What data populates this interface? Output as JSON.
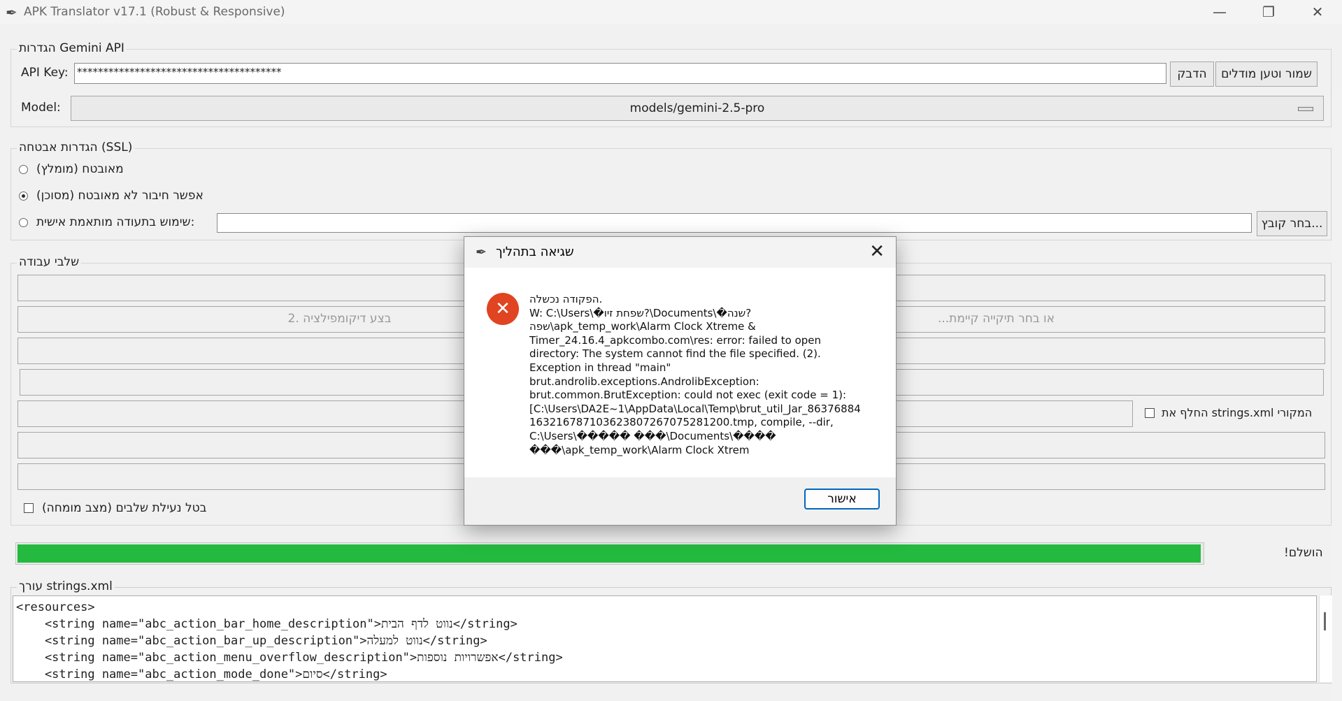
{
  "window": {
    "title": "APK Translator v17.1 (Robust & Responsive)",
    "minimize_glyph": "—",
    "restore_glyph": "❐",
    "close_glyph": "✕"
  },
  "api_group": {
    "legend": "הגדרות Gemini API",
    "api_key_label": "API Key:",
    "api_key_value": "***************************************",
    "paste_button": "הדבק",
    "save_load_button": "שמור וטען מודלים",
    "model_label": "Model:",
    "model_value": "models/gemini-2.5-pro"
  },
  "ssl_group": {
    "legend": "הגדרות אבטחה (SSL)",
    "options": [
      {
        "label": "מאובטח (מומלץ)",
        "selected": false
      },
      {
        "label": "אפשר חיבור לא מאובטח (מסוכן)",
        "selected": true
      },
      {
        "label": "שימוש בתעודה מותאמת אישית:",
        "selected": false
      }
    ],
    "cert_path": "",
    "choose_file_button": "בחר קובץ..."
  },
  "steps_group": {
    "legend": "שלבי עבודה",
    "decompile_button": "2. בצע דיקומפילציה",
    "choose_folder_button": "...או בחר תיקייה קיימת",
    "replace_strings_label": "החלף את strings.xml המקורי",
    "disable_lock_label": "בטל נעילת שלבים (מצב מומחה)"
  },
  "progress": {
    "value_percent": 100,
    "status": "!הושלם"
  },
  "editor": {
    "legend": "עורך strings.xml",
    "lines": [
      "<resources>",
      "    <string name=\"abc_action_bar_home_description\">נווט לדף הבית</string>",
      "    <string name=\"abc_action_bar_up_description\">נווט למעלה</string>",
      "    <string name=\"abc_action_menu_overflow_description\">אפשרויות נוספות</string>",
      "    <string name=\"abc_action_mode_done\">סיום</string>"
    ]
  },
  "dialog": {
    "title": "שגיאה בתהליך",
    "icon": "error-icon",
    "message_lines": [
      "הפקודה נכשלה.",
      "W: C:\\Users\\�שפחת זיו?\\Documents\\�שנה?",
      "שפה\\apk_temp_work\\Alarm Clock Xtreme &",
      "Timer_24.16.4_apkcombo.com\\res: error: failed to open",
      "directory: The system cannot find the file specified. (2).",
      "Exception in thread \"main\"",
      "brut.androlib.exceptions.AndrolibException:",
      "brut.common.BrutException: could not exec (exit code = 1):",
      "[C:\\Users\\DA2E~1\\AppData\\Local\\Temp\\brut_util_Jar_86376884",
      "16321678710362380726​7075281200.tmp, compile, --dir,",
      "C:\\Users\\����� ���\\Documents\\����",
      "���\\apk_temp_work\\Alarm Clock Xtrem"
    ],
    "ok_button": "אישור",
    "accent_color": "#0067c0",
    "error_color": "#e04420"
  }
}
